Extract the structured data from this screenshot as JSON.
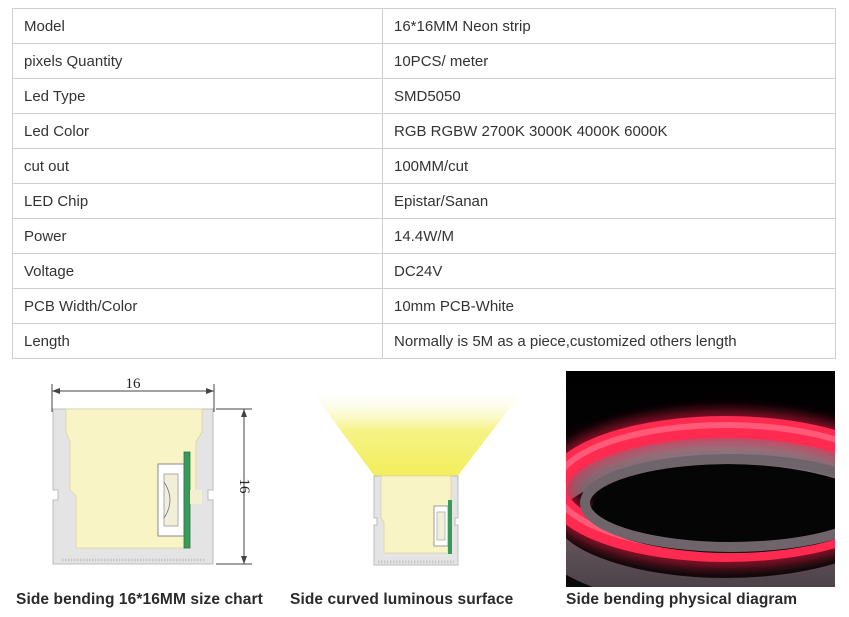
{
  "spec_table": {
    "rows": [
      {
        "label": "Model",
        "value": "16*16MM Neon strip"
      },
      {
        "label": "pixels Quantity",
        "value": "10PCS/ meter"
      },
      {
        "label": "Led Type",
        "value": "SMD5050"
      },
      {
        "label": "Led Color",
        "value": "RGB  RGBW 2700K 3000K 4000K 6000K"
      },
      {
        "label": "cut out",
        "value": "100MM/cut"
      },
      {
        "label": "LED Chip",
        "value": "Epistar/Sanan"
      },
      {
        "label": "Power",
        "value": "14.4W/M"
      },
      {
        "label": "Voltage",
        "value": "DC24V"
      },
      {
        "label": "PCB Width/Color",
        "value": "10mm PCB-White"
      },
      {
        "label": "Length",
        "value": "Normally is 5M as a piece,customized others length"
      }
    ]
  },
  "figures": {
    "size_chart": {
      "width_label": "16",
      "height_label": "16",
      "caption": "Side bending 16*16MM size chart"
    },
    "luminous": {
      "caption": "Side curved luminous surface"
    },
    "photo": {
      "caption": "Side bending physical diagram"
    }
  },
  "colors": {
    "silicone": "#e4e4e4",
    "diffuser": "#f8f4c6",
    "light_beam": "#f4f07a",
    "pcb_green": "#3a9a5c",
    "neon_red": "#ff1f48",
    "photo_bg": "#000000"
  }
}
